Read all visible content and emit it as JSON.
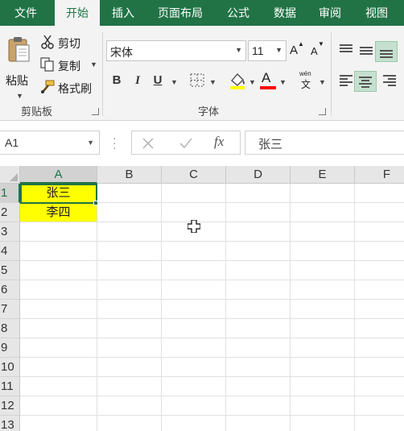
{
  "tabs": {
    "file": "文件",
    "home": "开始",
    "insert": "插入",
    "layout": "页面布局",
    "formula": "公式",
    "data": "数据",
    "review": "审阅",
    "view": "视图"
  },
  "clipboard": {
    "paste": "粘贴",
    "cut": "剪切",
    "copy": "复制",
    "format_painter": "格式刷",
    "group_label": "剪贴板"
  },
  "font": {
    "name": "宋体",
    "size": "11",
    "grow": "A",
    "shrink": "A",
    "bold": "B",
    "italic": "I",
    "underline": "U",
    "font_color_letter": "A",
    "phonetic_top": "wén",
    "phonetic_bottom": "文",
    "group_label": "字体",
    "font_color_hex": "#ff0000",
    "fill_color_hex": "#ffff00"
  },
  "formula_bar": {
    "name_box": "A1",
    "fx": "fx",
    "value": "张三"
  },
  "sheet": {
    "columns": [
      "A",
      "B",
      "C",
      "D",
      "E",
      "F"
    ],
    "rows": [
      "1",
      "2",
      "3",
      "4",
      "5",
      "6",
      "7",
      "8",
      "9",
      "10",
      "11",
      "12",
      "13"
    ],
    "cells": {
      "A1": "张三",
      "A2": "李四"
    },
    "highlight_hex": "#ffff00",
    "accent_hex": "#217346"
  }
}
